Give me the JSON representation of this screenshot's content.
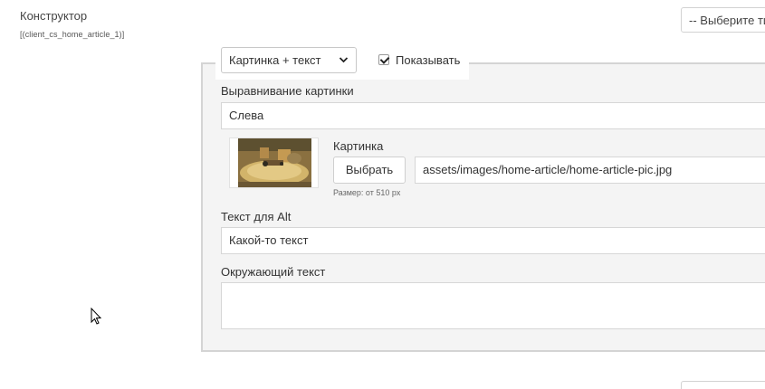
{
  "constructor_field": {
    "label": "Конструктор",
    "key": "[(client_cs_home_article_1)]",
    "type_select_placeholder": "-- Выберите тип"
  },
  "block": {
    "type_select_value": "Картинка + текст",
    "show_checked": true,
    "show_label": "Показывать",
    "image_align": {
      "label": "Выравнивание картинки",
      "value": "Слева"
    },
    "image": {
      "label": "Картинка",
      "choose_button": "Выбрать",
      "path": "assets/images/home-article/home-article-pic.jpg",
      "size_hint": "Размер: от 510 px"
    },
    "alt_text": {
      "label": "Текст для Alt",
      "value": "Какой-то текст"
    },
    "surrounding_text": {
      "label": "Окружающий текст",
      "value": ""
    }
  },
  "colors": {
    "panel_bg": "#f4f4f4",
    "panel_border": "#d4d4d4",
    "input_border": "#d6d6d6"
  },
  "icons": [
    "chevron-down-icon",
    "checkmark-icon",
    "mouse-cursor-icon"
  ]
}
